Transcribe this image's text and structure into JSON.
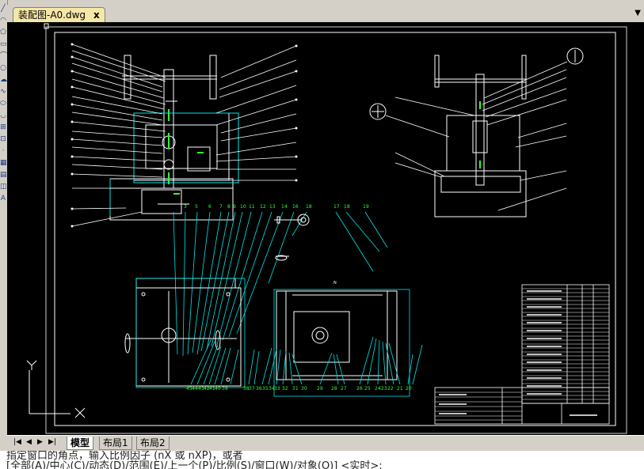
{
  "document_tab": {
    "label": "装配图-A0.dwg",
    "close_glyph": "x"
  },
  "layout_tabs": [
    {
      "label": "模型",
      "active": true
    },
    {
      "label": "布局1",
      "active": false
    },
    {
      "label": "布局2",
      "active": false
    }
  ],
  "nav_buttons": [
    "|◀",
    "◀",
    "▶",
    "▶|"
  ],
  "ucs": {
    "y_label": "Y",
    "x_label": "X"
  },
  "drawing": {
    "callouts_top": [
      "3",
      "5",
      "6",
      "7",
      "8",
      "9",
      "10",
      "11",
      "12",
      "13",
      "14",
      "16",
      "18",
      "17",
      "18",
      "19"
    ],
    "callouts_bottom_left": [
      "45",
      "44",
      "43",
      "42",
      "41",
      "40",
      "39",
      "38",
      "37",
      "36",
      "35",
      "34",
      "33",
      "32",
      "31",
      "30"
    ],
    "callouts_bottom_right": [
      "29",
      "28",
      "27",
      "26",
      "25",
      "24",
      "23",
      "22",
      "21",
      "20"
    ]
  },
  "command_line": {
    "line1": "指定窗口的角点，输入比例因子 (nX 或 nXP)，或者",
    "line2": "[全部(A)/中心(C)/动态(D)/范围(E)/上一个(P)/比例(S)/窗口(W)/对象(O)] <实时>:"
  },
  "colors": {
    "canvas": "#000000",
    "drawing_lines": "#ffffff",
    "leaders": "#00e5e5",
    "callout_text": "#33ff33",
    "tab_active": "#f4e7a8"
  }
}
